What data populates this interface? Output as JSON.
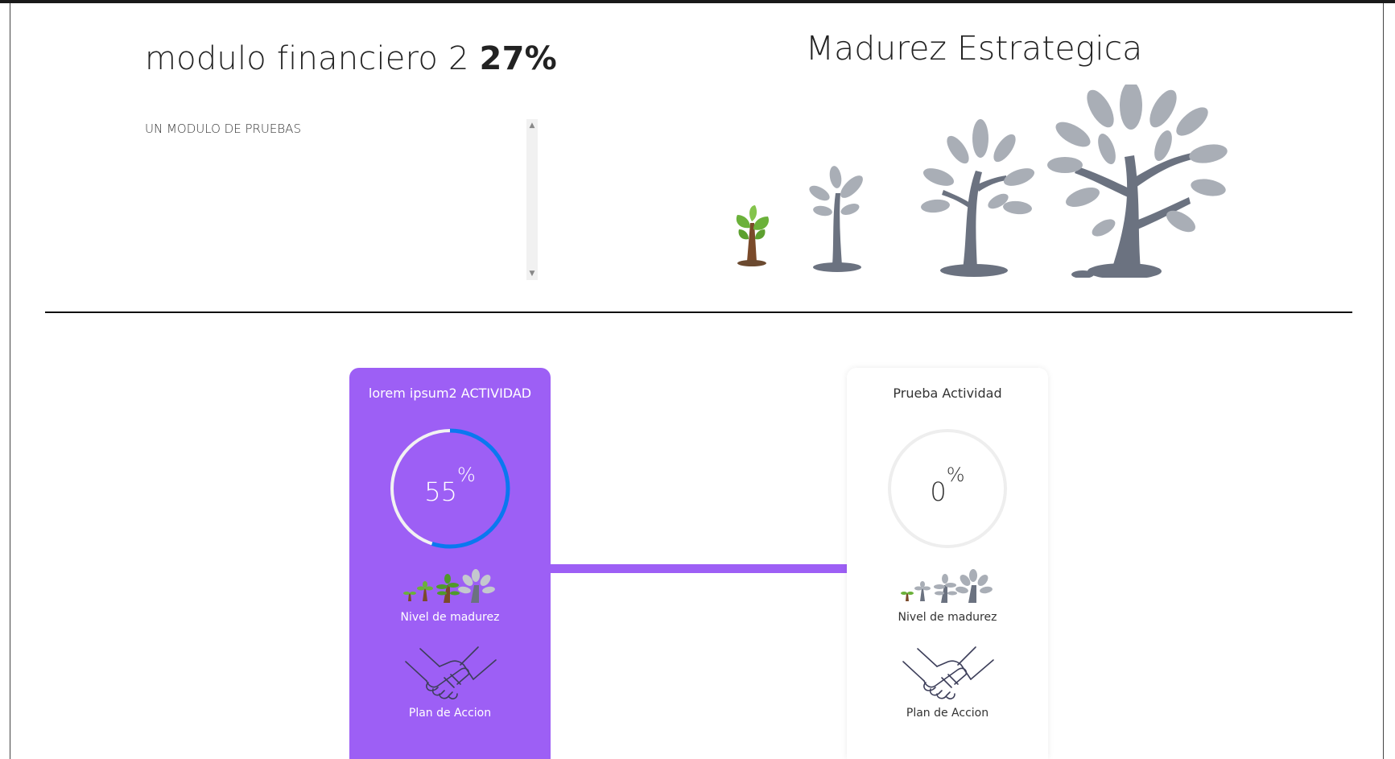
{
  "module": {
    "name": "modulo financiero 2",
    "percent": "27%",
    "description": "UN MODULO DE PRUEBAS"
  },
  "maturity": {
    "title": "Madurez Estrategica",
    "icons": [
      "seedling-icon",
      "sapling-icon",
      "young-tree-icon",
      "mature-tree-icon"
    ],
    "colors": {
      "leaf_green": "#6bb13a",
      "trunk_brown": "#7a4a2a",
      "tree_gray": "#6b7280",
      "leaf_gray": "#a9aeb6"
    }
  },
  "activities": [
    {
      "title": "lorem ipsum2 ACTIVIDAD",
      "percent_value": "55",
      "percent_sign": "%",
      "progress": 0.55,
      "maturity_label": "Nivel de madurez",
      "plan_label": "Plan de Accion",
      "card_color": "#9d5ff5",
      "ring_color": "#0a78f0"
    },
    {
      "title": "Prueba Actividad",
      "percent_value": "0",
      "percent_sign": "%",
      "progress": 0,
      "maturity_label": "Nivel de madurez",
      "plan_label": "Plan de Accion",
      "card_color": "#ffffff",
      "ring_color": "#0a78f0"
    }
  ]
}
